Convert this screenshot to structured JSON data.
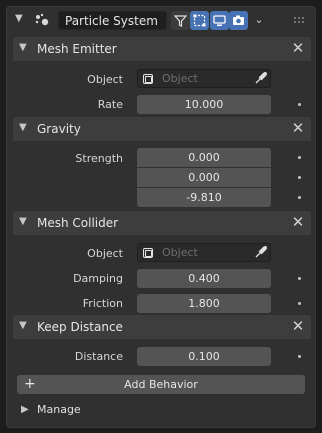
{
  "header": {
    "name": "Particle System",
    "icons": [
      "particle-system-icon",
      "filter-icon",
      "edit-mode-icon",
      "viewport-icon",
      "render-icon",
      "dropdown-chevron-icon",
      "drag-handle-icon"
    ]
  },
  "sections": {
    "mesh_emitter": {
      "title": "Mesh Emitter",
      "object_label": "Object",
      "object_placeholder": "Object",
      "rate_label": "Rate",
      "rate_value": "10.000"
    },
    "gravity": {
      "title": "Gravity",
      "strength_label": "Strength",
      "x": "0.000",
      "y": "0.000",
      "z": "-9.810"
    },
    "mesh_collider": {
      "title": "Mesh Collider",
      "object_label": "Object",
      "object_placeholder": "Object",
      "damping_label": "Damping",
      "damping_value": "0.400",
      "friction_label": "Friction",
      "friction_value": "1.800"
    },
    "keep_distance": {
      "title": "Keep Distance",
      "distance_label": "Distance",
      "distance_value": "0.100"
    }
  },
  "add_behavior_label": "Add Behavior",
  "manage_label": "Manage",
  "colors": {
    "accent": "#4772b3",
    "panel": "#303030",
    "section_header": "#3d3d3d",
    "field": "#545454"
  }
}
